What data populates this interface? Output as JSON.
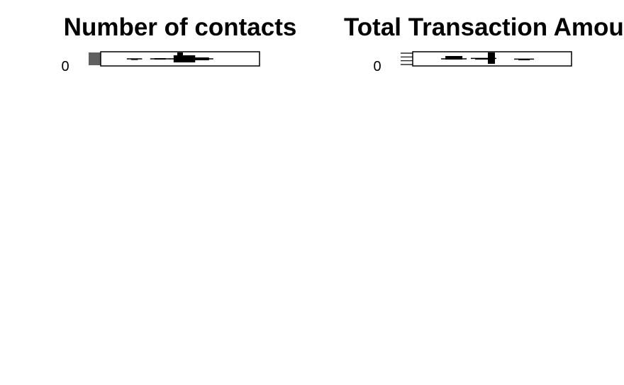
{
  "chart_data": [
    {
      "type": "boxplot",
      "title": "Number of contacts",
      "ytick_labels": [
        "0"
      ],
      "boxes": [
        {
          "offset": 0.62,
          "width": 0.38,
          "q1": 0.25,
          "median": 0.5,
          "q3": 0.75
        },
        {
          "offset": 0.44,
          "width": 0.2,
          "q1": 0.45,
          "median": 0.5,
          "q3": 0.55
        },
        {
          "offset": 0.75,
          "width": 0.25,
          "q1": 0.4,
          "median": 0.5,
          "q3": 0.6
        },
        {
          "offset": 0.25,
          "width": 0.12,
          "q1": 0.48,
          "median": 0.5,
          "q3": 0.52
        }
      ],
      "outlier_ticks": 9,
      "colors": {
        "line": "#000000",
        "fill": "#000000"
      }
    },
    {
      "type": "boxplot",
      "title": "Total Transaction Amount",
      "ytick_labels": [
        "0"
      ],
      "boxes": [
        {
          "offset": 0.2,
          "width": 0.3,
          "q1": 0.3,
          "median": 0.5,
          "q3": 0.55
        },
        {
          "offset": 0.42,
          "width": 0.3,
          "q1": 0.45,
          "median": 0.47,
          "q3": 0.5
        },
        {
          "offset": 0.72,
          "width": 0.2,
          "q1": 0.5,
          "median": 0.52,
          "q3": 0.55
        }
      ],
      "outlier_ticks": 4,
      "colors": {
        "line": "#000000",
        "fill": "#000000"
      }
    }
  ]
}
